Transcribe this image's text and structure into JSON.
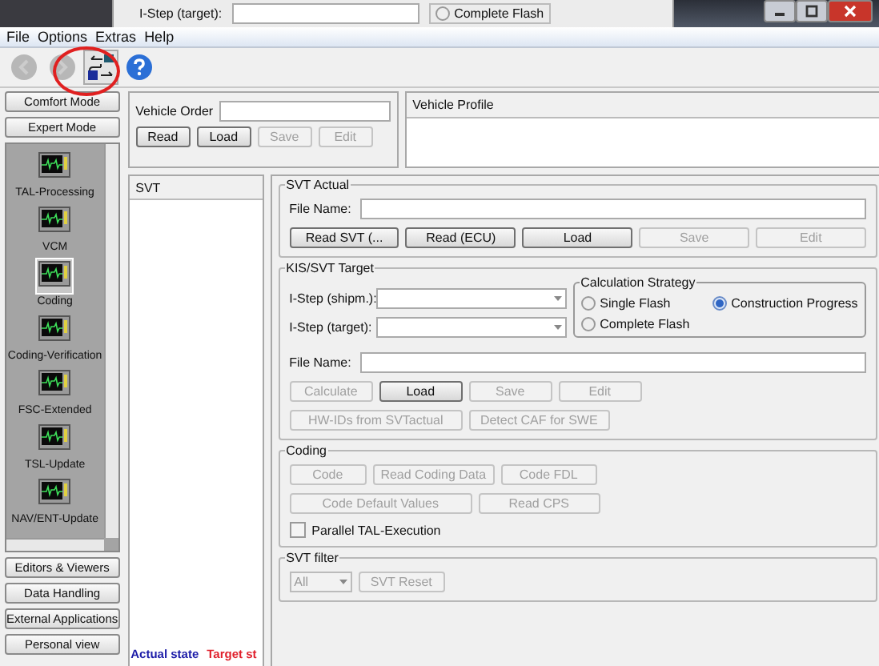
{
  "background_window": {
    "label": "I-Step (target):",
    "option": "Complete Flash"
  },
  "menu": [
    "File",
    "Options",
    "Extras",
    "Help"
  ],
  "toolbar": [
    {
      "kind": "back",
      "disabled": true
    },
    {
      "kind": "forward",
      "disabled": true
    },
    {
      "kind": "flow",
      "disabled": false
    },
    {
      "kind": "help",
      "disabled": false
    }
  ],
  "sidebar": {
    "top_buttons": [
      "Comfort Mode",
      "Expert Mode"
    ],
    "items": [
      {
        "label": "TAL-Processing",
        "selected": false
      },
      {
        "label": "VCM",
        "selected": false
      },
      {
        "label": "Coding",
        "selected": true
      },
      {
        "label": "Coding-Verification",
        "selected": false
      },
      {
        "label": "FSC-Extended",
        "selected": false
      },
      {
        "label": "TSL-Update",
        "selected": false
      },
      {
        "label": "NAV/ENT-Update",
        "selected": false
      }
    ],
    "bottom_buttons": [
      "Editors & Viewers",
      "Data Handling",
      "External Applications",
      "Personal view"
    ]
  },
  "vehicle_order": {
    "label": "Vehicle Order",
    "buttons": [
      {
        "label": "Read",
        "disabled": false
      },
      {
        "label": "Load",
        "disabled": false
      },
      {
        "label": "Save",
        "disabled": true
      },
      {
        "label": "Edit",
        "disabled": true
      }
    ]
  },
  "vehicle_profile": {
    "title": "Vehicle Profile"
  },
  "svt": {
    "title": "SVT",
    "legend": [
      {
        "label": "Actual state",
        "color": "#1c1ca8"
      },
      {
        "label": "Target st",
        "color": "#e0202c"
      }
    ]
  },
  "svt_actual": {
    "title": "SVT Actual",
    "file_label": "File Name:",
    "buttons": [
      {
        "label": "Read SVT (...",
        "disabled": false
      },
      {
        "label": "Read (ECU)",
        "disabled": false
      },
      {
        "label": "Load",
        "disabled": false
      },
      {
        "label": "Save",
        "disabled": true
      },
      {
        "label": "Edit",
        "disabled": true
      }
    ]
  },
  "kis_svt_target": {
    "title": "KIS/SVT Target",
    "fields": [
      {
        "label": "I-Step (shipm.):"
      },
      {
        "label": "I-Step (target):"
      }
    ],
    "strategy": {
      "title": "Calculation Strategy",
      "options": [
        {
          "label": "Single Flash",
          "selected": false
        },
        {
          "label": "Construction Progress",
          "selected": true
        },
        {
          "label": "Complete Flash",
          "selected": false
        }
      ]
    },
    "file_label": "File Name:",
    "buttons": [
      {
        "label": "Calculate",
        "disabled": true
      },
      {
        "label": "Load",
        "disabled": false
      },
      {
        "label": "Save",
        "disabled": true
      },
      {
        "label": "Edit",
        "disabled": true
      }
    ],
    "buttons_2": [
      {
        "label": "HW-IDs from SVTactual",
        "disabled": true
      },
      {
        "label": "Detect CAF for SWE",
        "disabled": true
      }
    ]
  },
  "coding": {
    "title": "Coding",
    "button_rows": [
      [
        {
          "label": "Code",
          "disabled": true
        },
        {
          "label": "Read Coding Data",
          "disabled": true
        },
        {
          "label": "Code FDL",
          "disabled": true
        }
      ],
      [
        {
          "label": "Code Default Values",
          "disabled": true
        },
        {
          "label": "Read CPS",
          "disabled": true
        }
      ]
    ],
    "parallel": {
      "label": "Parallel TAL-Execution",
      "checked": false
    }
  },
  "svt_filter": {
    "title": "SVT filter",
    "select": "All",
    "buttons": [
      {
        "label": "SVT Reset",
        "disabled": true
      }
    ]
  }
}
